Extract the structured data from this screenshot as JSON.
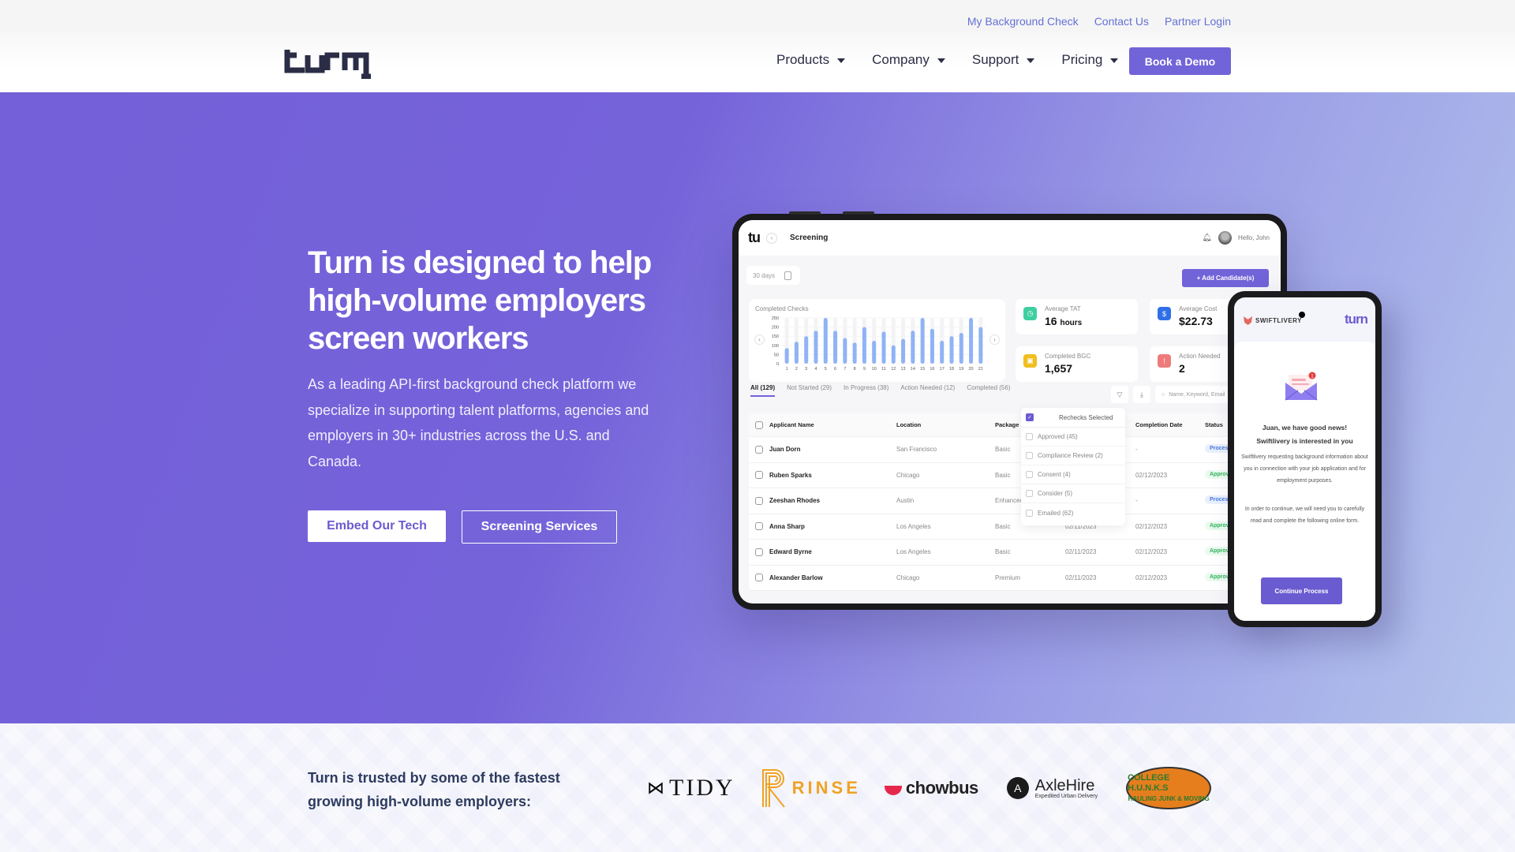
{
  "top_links": [
    "My Background Check",
    "Contact Us",
    "Partner Login"
  ],
  "brand": {
    "logo_text": "turn",
    "accent": "#7163d8"
  },
  "nav": {
    "items": [
      {
        "label": "Products",
        "icon": "caret-down-icon"
      },
      {
        "label": "Company",
        "icon": "caret-down-icon"
      },
      {
        "label": "Support",
        "icon": "caret-down-icon"
      },
      {
        "label": "Pricing",
        "icon": "caret-down-icon"
      }
    ],
    "cta": "Book a Demo"
  },
  "hero": {
    "title": "Turn is designed to help high-volume employers screen workers",
    "description": "As a leading API-first background check platform we specialize in supporting talent platforms, agencies and employers in 30+ industries across the U.S. and Canada.",
    "primary_button": "Embed Our Tech",
    "secondary_button": "Screening Services"
  },
  "dashboard": {
    "logo": "tu",
    "title": "Screening",
    "greeting": "Hello, John",
    "range": "30 days",
    "add_button": "+ Add Candidate(s)",
    "chart_title": "Completed Checks",
    "stats": [
      {
        "label": "Average TAT",
        "value": "16",
        "unit": "hours",
        "color": "#3ecfa0",
        "icon": "clock-icon"
      },
      {
        "label": "Average Cost",
        "value": "$22.73",
        "unit": "",
        "color": "#2f6fe8",
        "icon": "dollar-icon"
      },
      {
        "label": "Completed BGC",
        "value": "1,657",
        "unit": "",
        "color": "#f0be1f",
        "icon": "badge-icon"
      },
      {
        "label": "Action Needed",
        "value": "2",
        "unit": "",
        "color": "#ee7b7b",
        "icon": "alert-icon"
      }
    ],
    "tabs": [
      "All (129)",
      "Not Started (29)",
      "In Progress (38)",
      "Action Needed (12)",
      "Completed (56)"
    ],
    "search_placeholder": "Name, Keyword, Email",
    "columns": [
      "Applicant Name",
      "Location",
      "Package",
      "",
      "Completion Date",
      "Status"
    ],
    "rows": [
      {
        "name": "Juan Dorn",
        "location": "San Francisco",
        "package": "Basic",
        "submitted": "",
        "completed": "-",
        "status": "Processing",
        "kind": "proc"
      },
      {
        "name": "Ruben Sparks",
        "location": "Chicago",
        "package": "Basic",
        "submitted": "",
        "completed": "02/12/2023",
        "status": "Approved",
        "kind": "appr"
      },
      {
        "name": "Zeeshan Rhodes",
        "location": "Austin",
        "package": "Enhanced",
        "submitted": "",
        "completed": "-",
        "status": "Processing",
        "kind": "proc"
      },
      {
        "name": "Anna Sharp",
        "location": "Los Angeles",
        "package": "Basic",
        "submitted": "02/11/2023",
        "completed": "02/12/2023",
        "status": "Approved",
        "kind": "appr"
      },
      {
        "name": "Edward Byrne",
        "location": "Los Angeles",
        "package": "Basic",
        "submitted": "02/11/2023",
        "completed": "02/12/2023",
        "status": "Approved",
        "kind": "appr"
      },
      {
        "name": "Alexander Barlow",
        "location": "Chicago",
        "package": "Premium",
        "submitted": "02/11/2023",
        "completed": "02/12/2023",
        "status": "Approved",
        "kind": "appr"
      }
    ],
    "filter_dropdown": {
      "header": "Rechecks Selected",
      "options": [
        "Approved (45)",
        "Compliance Review (2)",
        "Consent (4)",
        "Consider (5)",
        "Emailed (62)"
      ]
    }
  },
  "chart_data": {
    "type": "bar",
    "title": "Completed Checks",
    "categories": [
      "1",
      "2",
      "3",
      "4",
      "5",
      "6",
      "7",
      "8",
      "9",
      "10",
      "11",
      "12",
      "13",
      "14",
      "15",
      "16",
      "17",
      "18",
      "19",
      "20",
      "21"
    ],
    "values": [
      85,
      120,
      150,
      180,
      250,
      180,
      140,
      115,
      200,
      125,
      175,
      100,
      135,
      180,
      250,
      190,
      125,
      150,
      168,
      250,
      200
    ],
    "yticks": [
      0,
      50,
      100,
      150,
      200,
      250
    ],
    "ylim": [
      0,
      250
    ],
    "bar_color": "#8fb3f5",
    "grid": true
  },
  "phone": {
    "brand": "SWIFTLIVERY",
    "logo": "turn",
    "notification_count": "1",
    "headline_1": "Juan, we have good news!",
    "headline_2": "Swiftlivery is interested in you",
    "text_1": "Swiftlivery requesting background information about you in connection with your job application and for employment purposes.",
    "text_2": "In order to continue, we will need you to carefully read and complete the following online form.",
    "button": "Continue Process"
  },
  "trusted": {
    "heading": "Turn is trusted by some of the fastest growing high-volume employers:",
    "logos": [
      {
        "name": "TIDY"
      },
      {
        "name": "RINSE"
      },
      {
        "name": "chowbus"
      },
      {
        "name": "AxleHire",
        "tagline": "Expedited Urban Delivery"
      },
      {
        "name": "COLLEGE H.U.N.K.S",
        "tagline": "HAULING JUNK & MOVING"
      }
    ]
  }
}
